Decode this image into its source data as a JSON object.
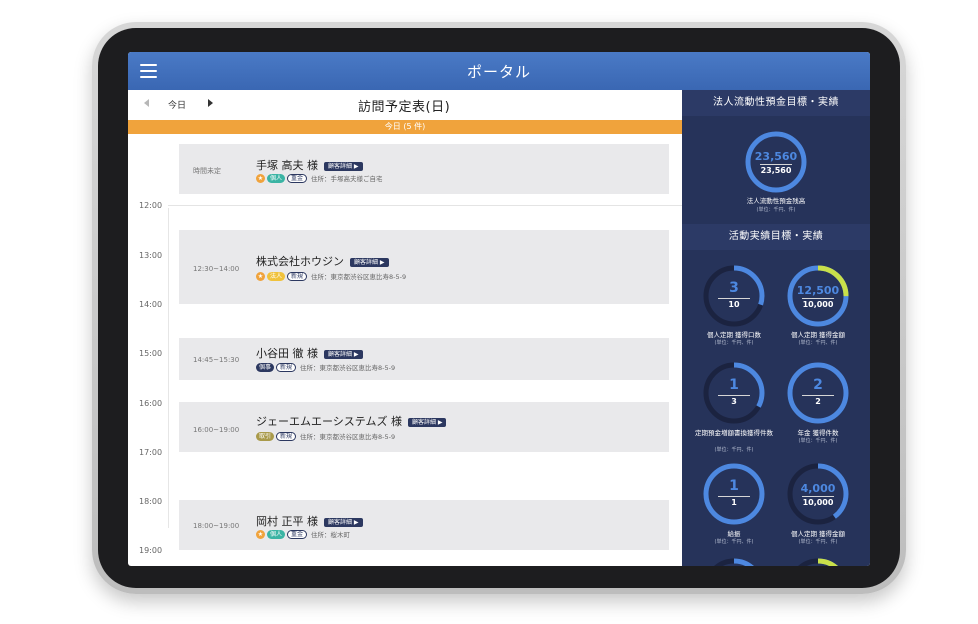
{
  "app": {
    "title": "ポータル"
  },
  "schedule": {
    "nav_today": "今日",
    "title": "訪問予定表(日)",
    "day_header": "今日 (5 件)",
    "time_labels": [
      "12:00",
      "13:00",
      "14:00",
      "15:00",
      "16:00",
      "17:00",
      "18:00",
      "19:00"
    ],
    "detail_button": "顧客詳細 ▶",
    "items": [
      {
        "time": "時間未定",
        "name": "手塚 高夫 様",
        "tags": [
          "個人",
          "重金"
        ],
        "address": "住所：手塚高夫様ご自宅"
      },
      {
        "time": "12:30~14:00",
        "name": "株式会社ホウジン",
        "tags": [
          "法人",
          "新規"
        ],
        "address": "住所：東京都渋谷区恵比寿8-5-9"
      },
      {
        "time": "14:45~15:30",
        "name": "小谷田 徹 様",
        "tags": [
          "個事",
          "新規"
        ],
        "address": "住所：東京都渋谷区恵比寿8-5-9"
      },
      {
        "time": "16:00~19:00",
        "name": "ジェーエムエーシステムズ 様",
        "tags": [
          "取引",
          "新規"
        ],
        "address": "住所：東京都渋谷区恵比寿8-5-9"
      },
      {
        "time": "18:00~19:00",
        "name": "岡村 正平 様",
        "tags": [
          "個人",
          "重金"
        ],
        "address": "住所：桜木町"
      }
    ]
  },
  "kpi": {
    "section1_title": "法人流動性預金目標・実績",
    "section2_title": "活動実績目標・実績",
    "unit_note": "(単位：千円、件)",
    "main_gauge": {
      "actual": "23,560",
      "target": "23,560",
      "label": "法人流動性預金残高",
      "progress": 1.0
    },
    "gauges": [
      {
        "actual": "3",
        "target": "10",
        "label": "個人定期 獲得口数",
        "progress": 0.3
      },
      {
        "actual": "12,500",
        "target": "10,000",
        "label": "個人定期 獲得金額",
        "progress": 1.0
      },
      {
        "actual": "1",
        "target": "3",
        "label": "定期預金増額書換獲得件数",
        "progress": 0.33
      },
      {
        "actual": "2",
        "target": "2",
        "label": "年金 獲得件数",
        "progress": 1.0
      },
      {
        "actual": "1",
        "target": "1",
        "label": "給振",
        "progress": 1.0
      },
      {
        "actual": "4,000",
        "target": "10,000",
        "label": "個人定期 獲得金額",
        "progress": 0.4
      }
    ]
  },
  "colors": {
    "topbar": "#3d6cb8",
    "accent_orange": "#f0a33c",
    "panel_bg": "#26335a",
    "gauge_blue": "#4d88e0",
    "gauge_overflow": "#c9e04a",
    "gauge_track": "#1b2340",
    "tag_kojin": "#3bb4a4",
    "tag_hojin": "#f0c23c",
    "tag_kozi": "#2c3860",
    "tag_torihiki": "#a99a4a"
  }
}
